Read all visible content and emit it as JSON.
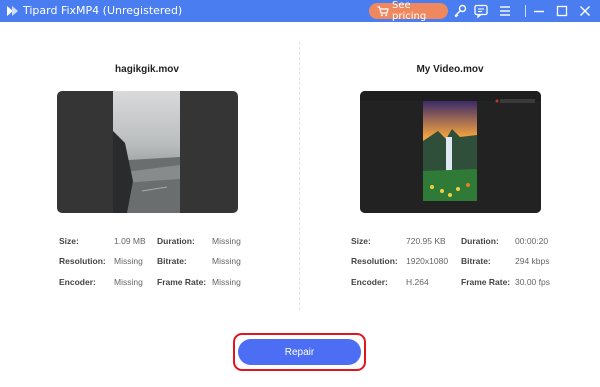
{
  "app": {
    "title": "Tipard FixMP4 (Unregistered)"
  },
  "titlebar": {
    "pricing_label": "See pricing",
    "icons": [
      "cart-icon",
      "key-icon",
      "feedback-icon",
      "menu-icon",
      "minimize-icon",
      "maximize-icon",
      "close-icon"
    ]
  },
  "left": {
    "filename": "hagikgik.mov",
    "size_label": "Size:",
    "size": "1.09 MB",
    "duration_label": "Duration:",
    "duration": "Missing",
    "resolution_label": "Resolution:",
    "resolution": "Missing",
    "bitrate_label": "Bitrate:",
    "bitrate": "Missing",
    "encoder_label": "Encoder:",
    "encoder": "Missing",
    "framerate_label": "Frame Rate:",
    "framerate": "Missing"
  },
  "right": {
    "filename": "My Video.mov",
    "size_label": "Size:",
    "size": "720.95 KB",
    "duration_label": "Duration:",
    "duration": "00:00:20",
    "resolution_label": "Resolution:",
    "resolution": "1920x1080",
    "bitrate_label": "Bitrate:",
    "bitrate": "294 kbps",
    "encoder_label": "Encoder:",
    "encoder": "H.264",
    "framerate_label": "Frame Rate:",
    "framerate": "30.00 fps"
  },
  "repair": {
    "label": "Repair"
  },
  "colors": {
    "titlebar": "#4a7ef0",
    "pricing": "#f0885f",
    "repair": "#4c6ef5",
    "highlight": "#e0161c"
  }
}
